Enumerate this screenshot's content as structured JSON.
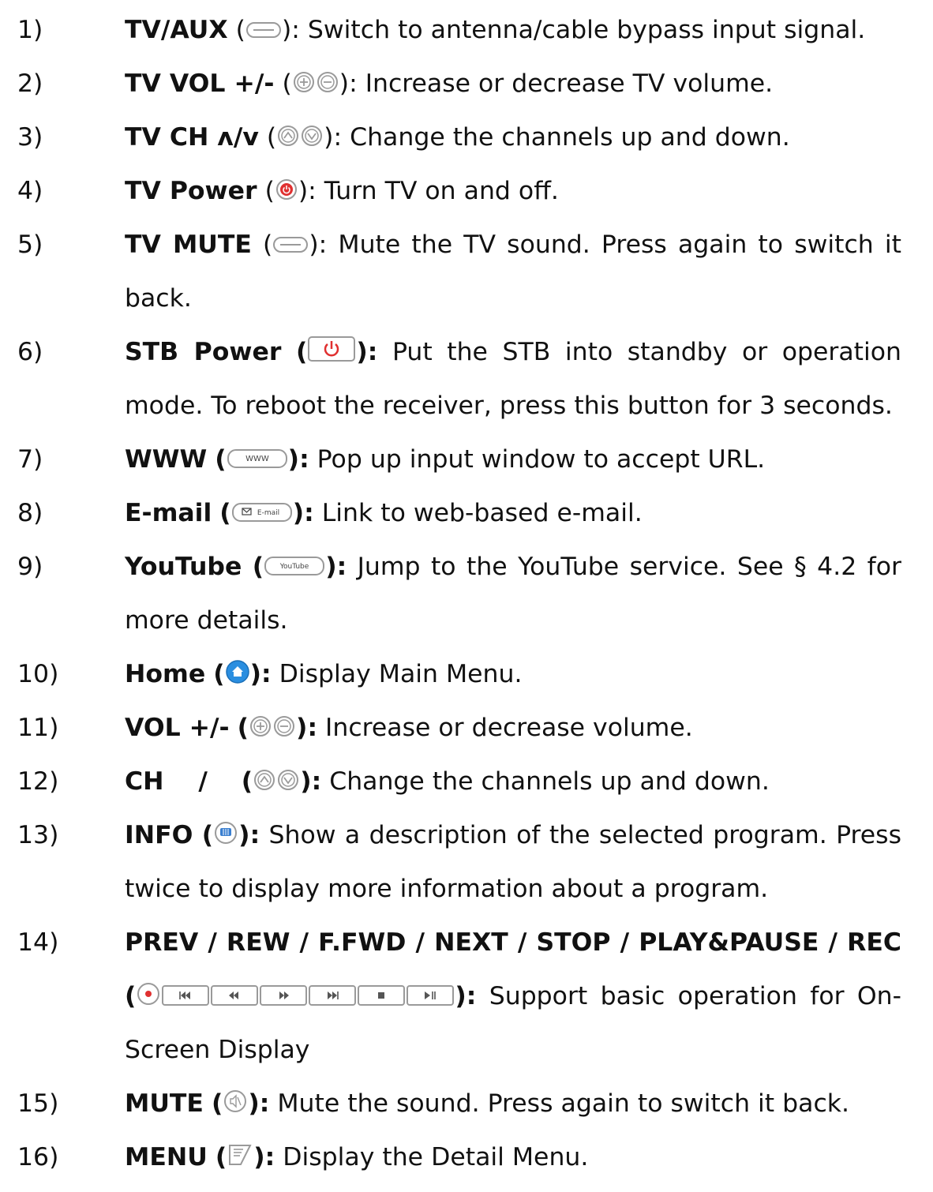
{
  "items": [
    {
      "num": "1)",
      "label": "TV/AUX",
      "paren": "(",
      "close": ")",
      "close_bold": false,
      "desc": ": Switch to antenna/cable bypass input signal.",
      "desc_bold": false,
      "icons": [
        "oval-button"
      ]
    },
    {
      "num": "2)",
      "label": "TV VOL +/-",
      "paren": "(",
      "close": ")",
      "close_bold": false,
      "desc": ": Increase or decrease TV volume.",
      "desc_bold": false,
      "icons": [
        "plus-circle",
        "minus-circle"
      ]
    },
    {
      "num": "3)",
      "label": "TV CH ʌ/v",
      "paren": "(",
      "close": ")",
      "close_bold": false,
      "desc": ": Change the channels up and down.",
      "desc_bold": false,
      "icons": [
        "up-circle",
        "down-circle"
      ]
    },
    {
      "num": "4)",
      "label": "TV Power",
      "paren": "(",
      "close": ")",
      "close_bold": false,
      "desc": ": Turn TV on and off.",
      "desc_bold": false,
      "icons": [
        "power-round"
      ]
    },
    {
      "num": "5)",
      "label": "TV MUTE",
      "paren": "(",
      "close": ")",
      "close_bold": false,
      "desc": ": Mute the TV sound. Press again to switch it back.",
      "desc_bold": false,
      "icons": [
        "oval-button"
      ]
    },
    {
      "num": "6)",
      "label": "STB Power",
      "paren": "(",
      "close": "):",
      "close_bold": true,
      "desc": " Put the STB into standby or operation mode. To reboot the receiver, press this button for 3 seconds.",
      "icons": [
        "power-rect"
      ]
    },
    {
      "num": "7)",
      "label": "WWW",
      "paren": "(",
      "close": "):",
      "close_bold": true,
      "desc": " Pop up input window to accept URL.",
      "icons": [
        "www-button"
      ]
    },
    {
      "num": "8)",
      "label": "E-mail",
      "paren": "(",
      "close": "):",
      "close_bold": true,
      "desc": " Link to web-based e-mail.",
      "icons": [
        "email-button"
      ]
    },
    {
      "num": "9)",
      "label": "YouTube",
      "paren": "(",
      "close": "):",
      "close_bold": true,
      "desc": " Jump to the YouTube service. See § 4.2 for more details.",
      "icons": [
        "youtube-button"
      ]
    },
    {
      "num": "10)",
      "label": "Home",
      "paren": "(",
      "close": "):",
      "close_bold": true,
      "desc": " Display Main Menu.",
      "icons": [
        "home-button"
      ]
    },
    {
      "num": "11)",
      "label": "VOL +/-",
      "paren": "(",
      "close": "):",
      "close_bold": true,
      "desc": " Increase or decrease volume.",
      "icons": [
        "plus-circle",
        "minus-circle"
      ]
    },
    {
      "num": "12)",
      "label": "CH    /   ",
      "paren": "(",
      "close": "):",
      "close_bold": true,
      "desc": " Change the channels up and down.",
      "icons": [
        "up-circle",
        "down-circle"
      ]
    },
    {
      "num": "13)",
      "label": "INFO",
      "paren": "(",
      "close": "):",
      "close_bold": true,
      "desc": " Show a description of the selected program. Press twice to display more information about a program.",
      "icons": [
        "info-button"
      ]
    },
    {
      "num": "14)",
      "label": "PREV / REW / F.FWD / NEXT / STOP / PLAY&PAUSE / REC",
      "paren": "(",
      "close": "):",
      "close_bold": true,
      "desc": " Support basic operation for On-Screen Display",
      "icons": [
        "rec-button",
        "prev-button",
        "rew-button",
        "ffwd-button",
        "next-button",
        "stop-button",
        "playpause-button"
      ]
    },
    {
      "num": "15)",
      "label": "MUTE",
      "paren": "(",
      "close": "):",
      "close_bold": true,
      "desc": " Mute the sound. Press again to switch it back.",
      "icons": [
        "mute-button"
      ]
    },
    {
      "num": "16)",
      "label": "MENU",
      "paren": "(",
      "close": "):",
      "close_bold": true,
      "desc": " Display the Detail Menu.",
      "icons": [
        "menu-button"
      ]
    }
  ],
  "icon_labels": {
    "www": "WWW",
    "email": "E-mail",
    "youtube": "YouTube"
  },
  "colors": {
    "power_red": "#e03030",
    "home_blue": "#2a8ee0",
    "info_blue": "#3a7fd0",
    "button_outline": "#9a9a9a"
  }
}
